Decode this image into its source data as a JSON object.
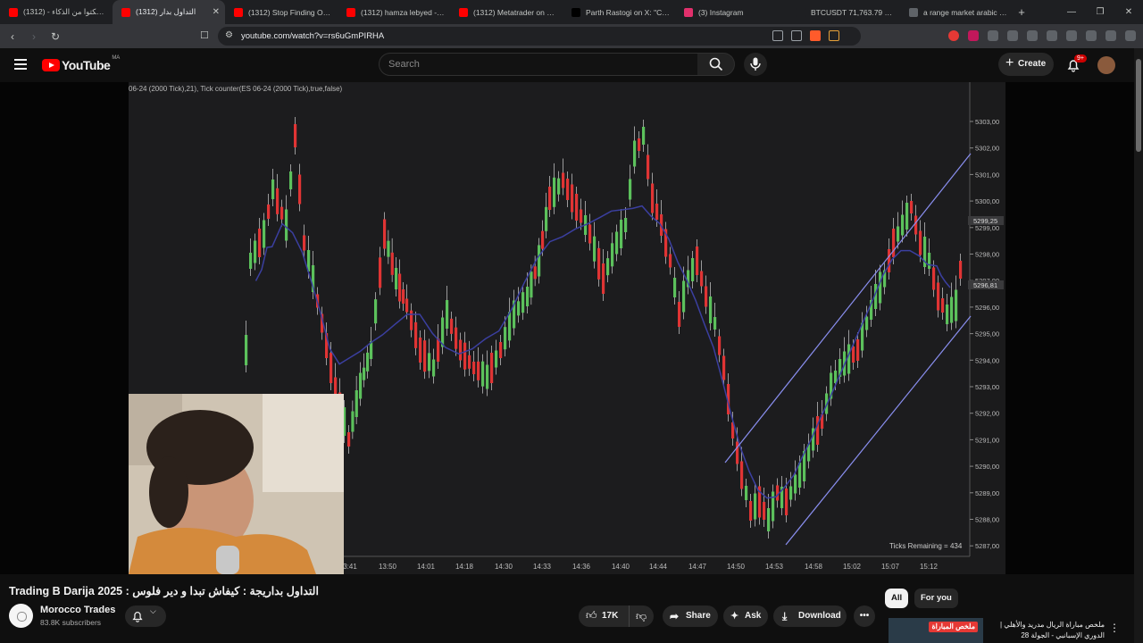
{
  "browser": {
    "tabs": [
      {
        "label": "(1312) - لا تشكتوا من الذكاء",
        "color": "#ff0000",
        "active": false
      },
      {
        "label": "(1312) التداول بدار",
        "color": "#ff0000",
        "active": true
      },
      {
        "label": "(1312) Stop Finding Offset",
        "color": "#ff0000",
        "active": false
      },
      {
        "label": "(1312) hamza lebyed - You",
        "color": "#ff0000",
        "active": false
      },
      {
        "label": "(1312) Metatrader on pho",
        "color": "#ff0000",
        "active": false
      },
      {
        "label": "Parth Rastogi on X: \"Crude",
        "color": "#000000",
        "active": false
      },
      {
        "label": "(3) Instagram",
        "color": "#e1306c",
        "active": false
      },
      {
        "label": "BTCUSDT 71,763.79 ▲ +0.",
        "color": "#1e1f22",
        "active": false
      },
      {
        "label": "a range market arabic - Ac",
        "color": "#5f6368",
        "active": false
      }
    ],
    "new_tab": "+",
    "url": "youtube.com/watch?v=rs6uGmPIRHA",
    "minimize": "—",
    "maximize": "❐",
    "close": "✕"
  },
  "header": {
    "logo_text": "YouTube",
    "country_code": "MA",
    "search_placeholder": "Search",
    "create_label": "Create",
    "notification_count": "9+"
  },
  "video": {
    "chart_header": "06-24 (2000 Tick),21), Tick counter(ES 06-24 (2000 Tick),true,false)",
    "price_ticks": [
      "5303,00",
      "5302,00",
      "5301,00",
      "5300,00",
      "5299,00",
      "5298,00",
      "5297,00",
      "5296,00",
      "5295,00",
      "5294,00",
      "5293,00",
      "5292,00",
      "5291,00",
      "5290,00",
      "5289,00",
      "5288,00",
      "5287,00"
    ],
    "price_tags": [
      "5299,25",
      "5296,81"
    ],
    "time_ticks": [
      "3:41",
      "13:50",
      "14:01",
      "14:18",
      "14:30",
      "14:33",
      "14:36",
      "14:40",
      "14:44",
      "14:47",
      "14:50",
      "14:53",
      "14:58",
      "15:02",
      "15:07",
      "15:12"
    ],
    "ticks_remaining": "Ticks Remaining = 434",
    "colors": {
      "up": "#5cc15c",
      "down": "#e03434",
      "channel": "#8a8ff0",
      "ma": "#3b3fa0"
    }
  },
  "info": {
    "title": "Trading B Darija 2025 : التداول بداريجة : كيفاش تبدا و دير فلوس",
    "channel_name": "Morocco Trades",
    "subscribers": "83.8K subscribers",
    "likes": "17K",
    "share": "Share",
    "ask": "Ask",
    "download": "Download",
    "chip_all": "All",
    "chip_for_you": "For you",
    "rec_title": "ملخص مباراة الريال مدريد والأهلي | الدوري الإسبانبي - الجولة 28",
    "rec_tag": "ملخص المباراة"
  }
}
